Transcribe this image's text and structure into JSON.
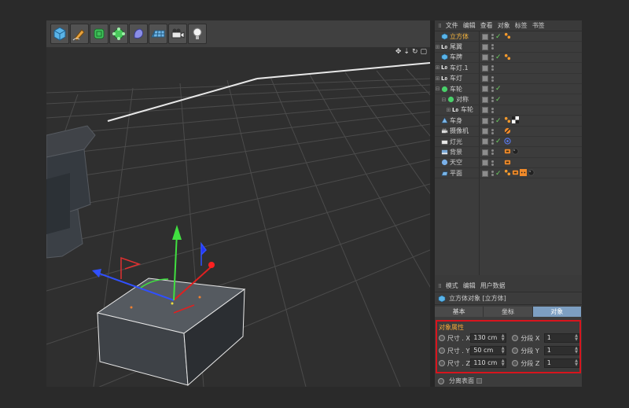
{
  "toolbar": {
    "tools": [
      "cube-icon",
      "pen-icon",
      "subdivide-icon",
      "array-icon",
      "deformer-icon",
      "floor-icon",
      "camera-icon",
      "light-icon"
    ]
  },
  "object_manager": {
    "menu": [
      "文件",
      "编辑",
      "查看",
      "对象",
      "标签",
      "书签"
    ],
    "rows": [
      {
        "name": "立方体",
        "prefix": "",
        "icon": "cube",
        "active": true,
        "tick": true,
        "tags": [
          "phong"
        ]
      },
      {
        "name": "尾翼",
        "prefix": "⊞",
        "icon": "L0",
        "tick": false,
        "tags": []
      },
      {
        "name": "车牌",
        "prefix": "",
        "icon": "cube",
        "tick": true,
        "tags": [
          "phong"
        ]
      },
      {
        "name": "车灯.1",
        "prefix": "⊞",
        "icon": "L0",
        "tick": false,
        "tags": []
      },
      {
        "name": "车灯",
        "prefix": "⊞",
        "icon": "L0",
        "tick": false,
        "tags": []
      },
      {
        "name": "车轮",
        "prefix": "⊟",
        "icon": "sphere",
        "tick": true,
        "tags": []
      },
      {
        "name": "对称",
        "prefix": "⊟",
        "icon": "sphere",
        "tick": true,
        "tags": []
      },
      {
        "name": "车轮",
        "prefix": "⊞",
        "icon": "L0",
        "tick": false,
        "tags": []
      },
      {
        "name": "车身",
        "prefix": "",
        "icon": "mesh",
        "tick": true,
        "tags": [
          "phong",
          "checker"
        ]
      },
      {
        "name": "摄像机",
        "prefix": "",
        "icon": "camera",
        "tick": false,
        "tags": [
          "stop"
        ]
      },
      {
        "name": "灯光",
        "prefix": "",
        "icon": "light",
        "tick": true,
        "tags": [
          "target"
        ]
      },
      {
        "name": "背景",
        "prefix": "",
        "icon": "bg",
        "tick": false,
        "tags": [
          "render",
          "sphere-dark"
        ]
      },
      {
        "name": "天空",
        "prefix": "",
        "icon": "sky",
        "tick": false,
        "tags": [
          "render"
        ]
      },
      {
        "name": "平面",
        "prefix": "",
        "icon": "plane",
        "tick": true,
        "tags": [
          "phong",
          "render",
          "dots",
          "sphere-dark"
        ]
      }
    ]
  },
  "attributes": {
    "menu": [
      "模式",
      "编辑",
      "用户数据"
    ],
    "title": "立方体对象 [立方体]",
    "tabs": [
      "基本",
      "坐标",
      "对象"
    ],
    "section": "对象属性",
    "size_x_label": "尺寸 . X",
    "size_x": "130 cm",
    "size_y_label": "尺寸 . Y",
    "size_y": "50 cm",
    "size_z_label": "尺寸 . Z",
    "size_z": "110 cm",
    "seg_x_label": "分段 X",
    "seg_x": "1",
    "seg_y_label": "分段 Y",
    "seg_y": "1",
    "seg_z_label": "分段 Z",
    "seg_z": "1",
    "separate_label": "分离表面"
  },
  "colors": {
    "accent_active": "#f6b53d",
    "highlight_border": "#d8141d",
    "tab_selected": "#7d9fc2",
    "axis_x": "#e02020",
    "axis_y": "#40e040",
    "axis_z": "#3050ff"
  }
}
